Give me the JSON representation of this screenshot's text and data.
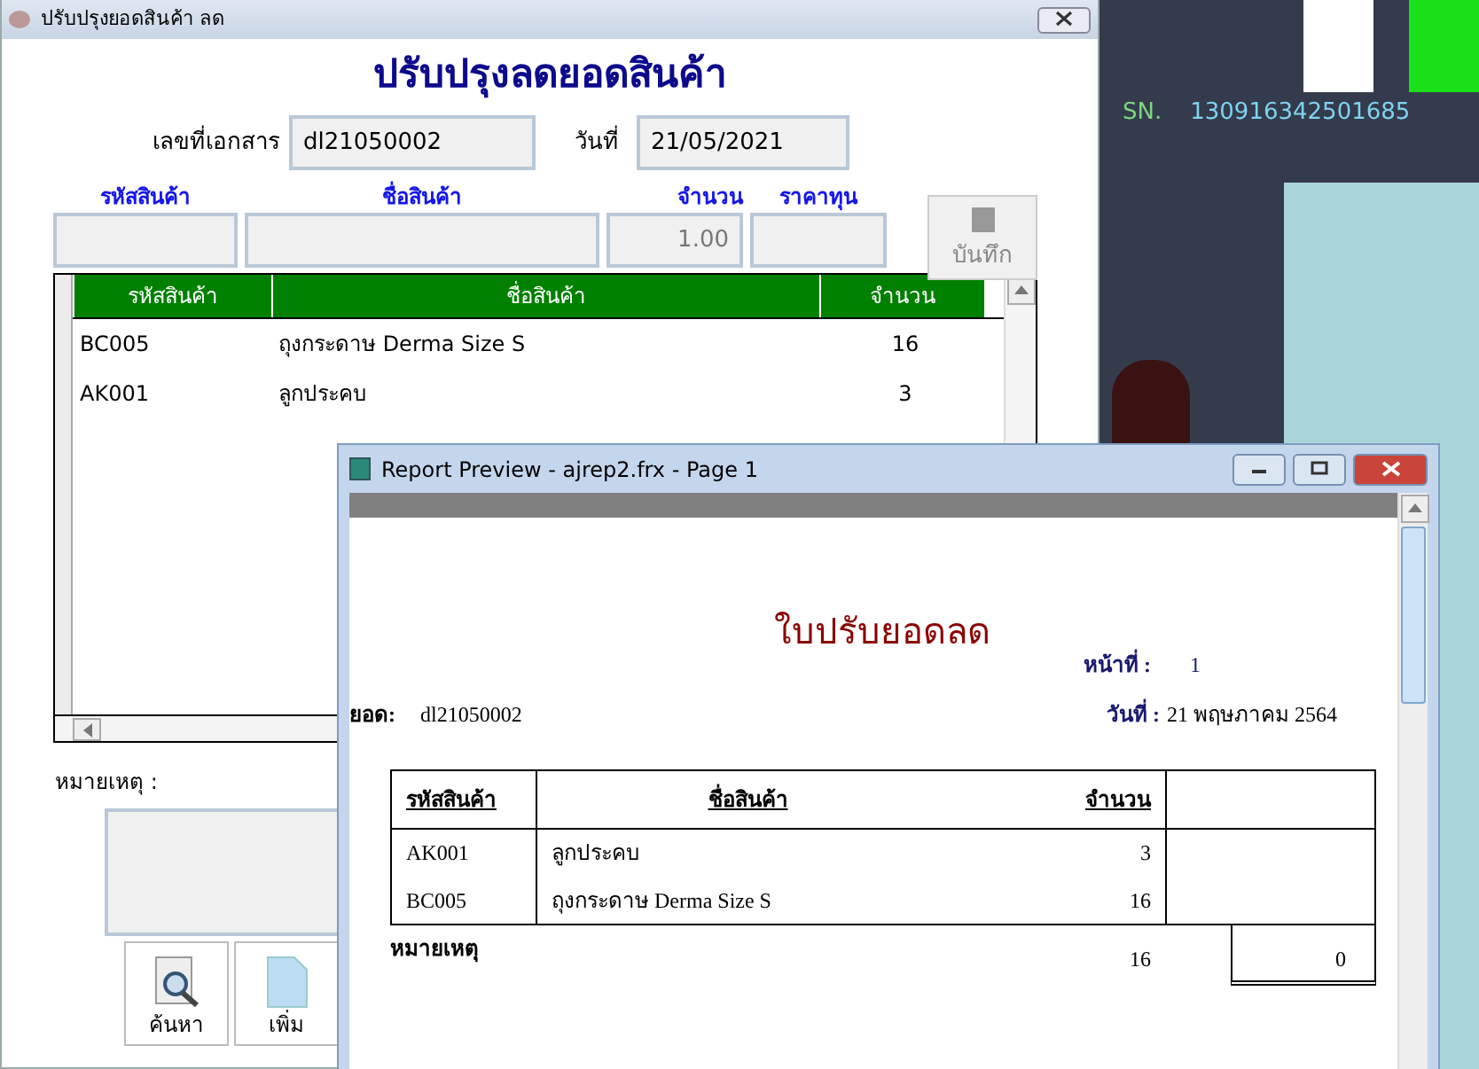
{
  "desktop": {
    "serial_label": "SN.",
    "serial": "130916342501685"
  },
  "main_window": {
    "title": "ปรับปรุงยอดสินค้า ลด",
    "heading": "ปรับปรุงลดยอดสินค้า",
    "doc_no": {
      "label": "เลขที่เอกสาร",
      "value": "dl21050002"
    },
    "date": {
      "label": "วันที่",
      "value": "21/05/2021"
    },
    "entry_fields": [
      {
        "label": "รหัสสินค้า"
      },
      {
        "label": "ชื่อสินค้า"
      },
      {
        "label": "จำนวน",
        "value": "1.00"
      },
      {
        "label": "ราคาทุน"
      }
    ],
    "save_button": {
      "label": "บันทึก",
      "disabled": true
    },
    "grid": {
      "columns": [
        "รหัสสินค้า",
        "ชื่อสินค้า",
        "จำนวน"
      ],
      "rows": [
        [
          "BC005",
          "ถุงกระดาษ Derma Size S",
          "16"
        ],
        [
          "AK001",
          "ลูกประคบ",
          "3"
        ]
      ]
    },
    "remarks_label": "หมายเหตุ :",
    "buttons": [
      {
        "label": "ค้นหา",
        "kind": "search"
      },
      {
        "label": "เพิ่ม",
        "kind": "new"
      }
    ]
  },
  "report_window": {
    "title": "Report Preview - ajrep2.frx - Page 1",
    "heading": "ใบปรับยอดลด",
    "page_label": "หน้าที่ :",
    "page": "1",
    "doc_label": "ยอด:",
    "doc": "dl21050002",
    "date_label": "วันที่ :",
    "date": "21 พฤษภาคม 2564",
    "columns": [
      "รหัสสินค้า",
      "ชื่อสินค้า",
      "จำนวน"
    ],
    "rows": [
      [
        "AK001",
        "ลูกประคบ",
        "3"
      ],
      [
        "BC005",
        "ถุงกระดาษ Derma Size S",
        "16"
      ]
    ],
    "footer": {
      "label": "หมายเหตุ",
      "total": "16",
      "box_value": "0"
    }
  }
}
